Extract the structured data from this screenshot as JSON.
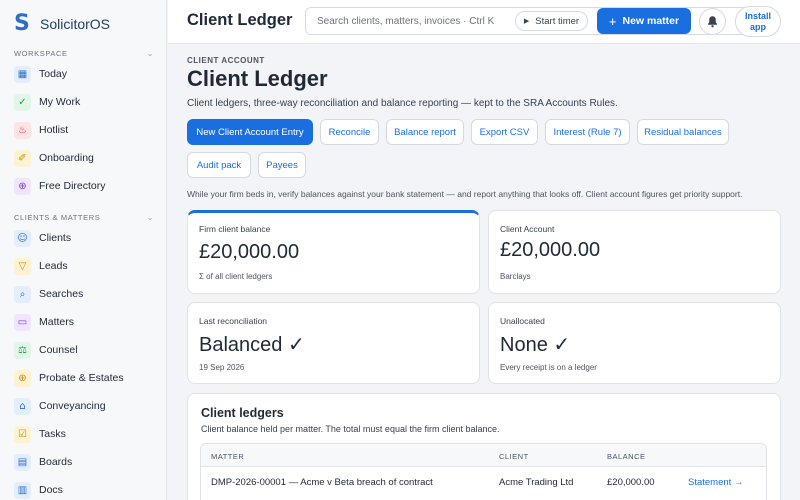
{
  "sidebar": {
    "brand": {
      "logo": "S",
      "name": "SolicitorOS"
    },
    "sections": [
      {
        "label": "WORKSPACE",
        "chevron": "⌄",
        "items": [
          {
            "label": "Today",
            "icon": "grid-icon",
            "glyph": "▦",
            "color": "#2e6ec6",
            "bg": "#e3edfb"
          },
          {
            "label": "My Work",
            "icon": "check-square-icon",
            "glyph": "✓",
            "color": "#16a34a",
            "bg": "#e2f5e8"
          },
          {
            "label": "Hotlist",
            "icon": "flame-icon",
            "glyph": "♨",
            "color": "#dc2626",
            "bg": "#fde4e4"
          },
          {
            "label": "Onboarding",
            "icon": "brush-icon",
            "glyph": "✐",
            "color": "#ca8a04",
            "bg": "#fdf3d3"
          },
          {
            "label": "Free Directory",
            "icon": "search-globe-icon",
            "glyph": "⊕",
            "color": "#7c3aed",
            "bg": "#efe6fd"
          }
        ]
      },
      {
        "label": "CLIENTS & MATTERS",
        "chevron": "⌄",
        "items": [
          {
            "label": "Clients",
            "icon": "user-icon",
            "glyph": "☺",
            "color": "#2e6ec6",
            "bg": "#e3edfb"
          },
          {
            "label": "Leads",
            "icon": "funnel-icon",
            "glyph": "▽",
            "color": "#ca8a04",
            "bg": "#fdf3d3"
          },
          {
            "label": "Searches",
            "icon": "search-icon",
            "glyph": "⌕",
            "color": "#2e6ec6",
            "bg": "#e3edfb"
          },
          {
            "label": "Matters",
            "icon": "folder-icon",
            "glyph": "▭",
            "color": "#7c3aed",
            "bg": "#efe6fd"
          },
          {
            "label": "Counsel",
            "icon": "scales-icon",
            "glyph": "⚖",
            "color": "#16a34a",
            "bg": "#e2f5e8"
          },
          {
            "label": "Probate & Estates",
            "icon": "coin-icon",
            "glyph": "⊕",
            "color": "#ca8a04",
            "bg": "#fdf3d3"
          },
          {
            "label": "Conveyancing",
            "icon": "house-icon",
            "glyph": "⌂",
            "color": "#2e6ec6",
            "bg": "#e3edfb"
          },
          {
            "label": "Tasks",
            "icon": "task-icon",
            "glyph": "☑",
            "color": "#ca8a04",
            "bg": "#fdf3d3"
          },
          {
            "label": "Boards",
            "icon": "board-icon",
            "glyph": "▤",
            "color": "#2e6ec6",
            "bg": "#e3edfb"
          },
          {
            "label": "Docs",
            "icon": "doc-icon",
            "glyph": "▥",
            "color": "#2e6ec6",
            "bg": "#e3edfb"
          }
        ]
      }
    ]
  },
  "topbar": {
    "title": "Client Ledger",
    "search_placeholder": "Search clients, matters, invoices · Ctrl K",
    "timer_label": "Start timer",
    "new_matter_label": "New matter",
    "install_label_1": "Install",
    "install_label_2": "app"
  },
  "main": {
    "eyebrow": "CLIENT ACCOUNT",
    "title": "Client Ledger",
    "subtitle": "Client ledgers, three-way reconciliation and balance reporting — kept to the SRA Accounts Rules.",
    "actions": [
      "New Client Account Entry",
      "Reconcile",
      "Balance report",
      "Export CSV",
      "Interest (Rule 7)",
      "Residual balances",
      "Audit pack",
      "Payees"
    ],
    "notice": "While your firm beds in, verify balances against your bank statement — and report anything that looks off. Client account figures get priority support.",
    "cards": [
      {
        "label": "Firm client balance",
        "value": "£20,000.00",
        "note": "Σ of all client ledgers"
      },
      {
        "label": "Client Account",
        "value": "£20,000.00",
        "note": "Barclays"
      },
      {
        "label": "Last reconciliation",
        "value": "Balanced ✓",
        "note": "19 Sep 2026"
      },
      {
        "label": "Unallocated",
        "value": "None ✓",
        "note": "Every receipt is on a ledger"
      }
    ],
    "ledgers": {
      "title": "Client ledgers",
      "subtitle": "Client balance held per matter. The total must equal the firm client balance.",
      "columns": [
        "MATTER",
        "CLIENT",
        "BALANCE"
      ],
      "rows": [
        {
          "matter": "DMP-2026-00001 — Acme v Beta breach of contract",
          "client": "Acme Trading Ltd",
          "balance": "£20,000.00",
          "action": "Statement →"
        }
      ]
    }
  },
  "colors": {
    "accent": "#1a6fe0",
    "brand": "#2e6ec6"
  }
}
